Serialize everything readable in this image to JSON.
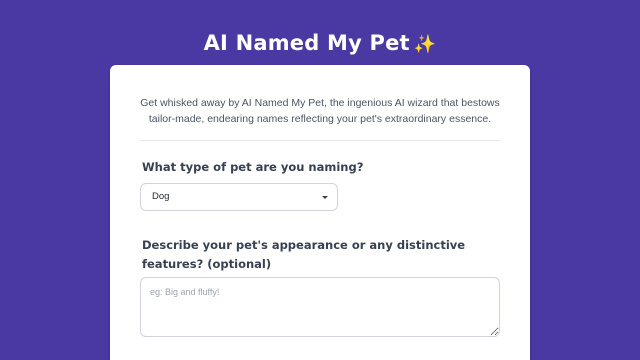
{
  "header": {
    "title": "AI Named My Pet",
    "sparkle": "✨"
  },
  "card": {
    "intro": "Get whisked away by AI Named My Pet, the ingenious AI wizard that bestows tailor-made, endearing names reflecting your pet's extraordinary essence.",
    "pet_type": {
      "label": "What type of pet are you naming?",
      "selected": "Dog"
    },
    "description": {
      "label": "Describe your pet's appearance or any distinctive features? (optional)",
      "placeholder": "eg: Big and fluffy!"
    }
  },
  "colors": {
    "background": "#4a38a3",
    "card": "#ffffff",
    "sparkle": "#f6c945"
  }
}
